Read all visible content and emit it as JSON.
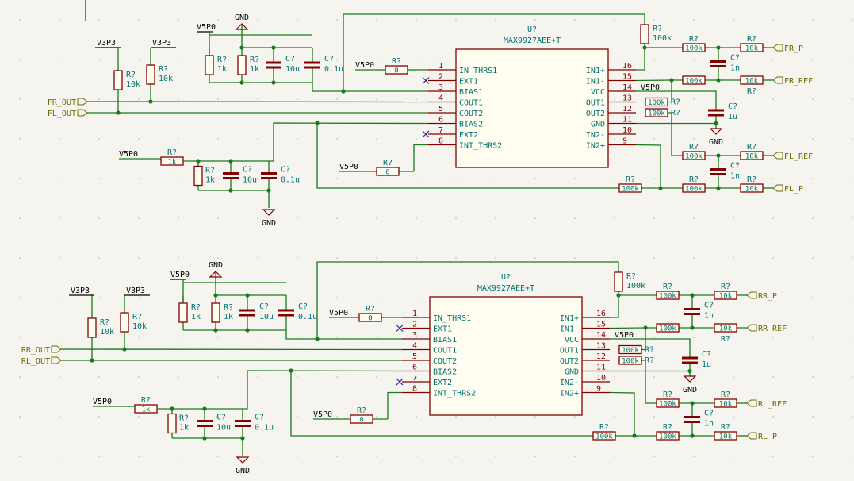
{
  "chips": [
    {
      "ref": "U?",
      "part": "MAX9927AEE+T",
      "left_pins": [
        {
          "num": "1",
          "name": "IN_THRS1"
        },
        {
          "num": "2",
          "name": "EXT1"
        },
        {
          "num": "3",
          "name": "BIAS1"
        },
        {
          "num": "4",
          "name": "COUT1"
        },
        {
          "num": "5",
          "name": "COUT2"
        },
        {
          "num": "6",
          "name": "BIAS2"
        },
        {
          "num": "7",
          "name": "EXT2"
        },
        {
          "num": "8",
          "name": "INT_THRS2"
        }
      ],
      "right_pins": [
        {
          "num": "16",
          "name": "IN1+"
        },
        {
          "num": "15",
          "name": "IN1-"
        },
        {
          "num": "14",
          "name": "VCC"
        },
        {
          "num": "13",
          "name": "OUT1"
        },
        {
          "num": "12",
          "name": "OUT2"
        },
        {
          "num": "11",
          "name": "GND"
        },
        {
          "num": "10",
          "name": "IN2-"
        },
        {
          "num": "9",
          "name": "IN2+"
        }
      ],
      "labels": {
        "out1": "FR_OUT",
        "out2": "FL_OUT",
        "p1": "FR_P",
        "ref1": "FR_REF",
        "ref2": "FL_REF",
        "p2": "FL_P"
      }
    },
    {
      "ref": "U?",
      "part": "MAX9927AEE+T",
      "left_pins": [
        {
          "num": "1",
          "name": "IN_THRS1"
        },
        {
          "num": "2",
          "name": "EXT1"
        },
        {
          "num": "3",
          "name": "BIAS1"
        },
        {
          "num": "4",
          "name": "COUT1"
        },
        {
          "num": "5",
          "name": "COUT2"
        },
        {
          "num": "6",
          "name": "BIAS2"
        },
        {
          "num": "7",
          "name": "EXT2"
        },
        {
          "num": "8",
          "name": "INT_THRS2"
        }
      ],
      "right_pins": [
        {
          "num": "16",
          "name": "IN1+"
        },
        {
          "num": "15",
          "name": "IN1-"
        },
        {
          "num": "14",
          "name": "VCC"
        },
        {
          "num": "13",
          "name": "OUT1"
        },
        {
          "num": "12",
          "name": "OUT2"
        },
        {
          "num": "11",
          "name": "GND"
        },
        {
          "num": "10",
          "name": "IN2-"
        },
        {
          "num": "9",
          "name": "IN2+"
        }
      ],
      "labels": {
        "out1": "RR_OUT",
        "out2": "RL_OUT",
        "p1": "RR_P",
        "ref1": "RR_REF",
        "ref2": "RL_REF",
        "p2": "RL_P"
      }
    }
  ],
  "nets": {
    "v5": "V5P0",
    "v33": "V3P3",
    "gnd": "GND"
  },
  "refs": {
    "r": "R?",
    "c": "C?"
  },
  "values": {
    "r1k": "1k",
    "r10k": "10k",
    "r100k": "100k",
    "r0": "0",
    "c10u": "10u",
    "c01u": "0.1u",
    "c1n": "1n",
    "c1u": "1u"
  }
}
